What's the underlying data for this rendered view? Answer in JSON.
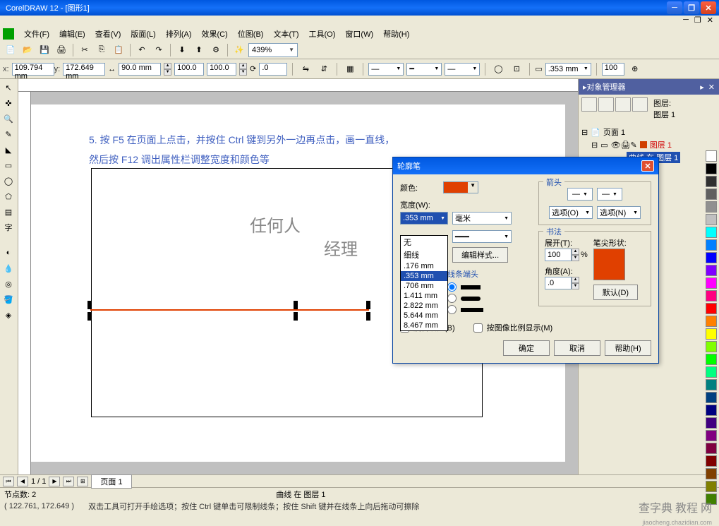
{
  "app": {
    "title": "CorelDRAW 12 - [图形1]"
  },
  "menu": [
    "文件(F)",
    "编辑(E)",
    "查看(V)",
    "版面(L)",
    "排列(A)",
    "效果(C)",
    "位图(B)",
    "文本(T)",
    "工具(O)",
    "窗口(W)",
    "帮助(H)"
  ],
  "zoom": "439%",
  "coords": {
    "x": "109.794 mm",
    "y": "172.649 mm",
    "w": "90.0 mm",
    "scale1": "100.0",
    "scale2": "100.0",
    "angle": ".0",
    "outline_w": ".353 mm",
    "opacity": "100"
  },
  "canvas": {
    "instr1": "5. 按 F5 在页面上点击，并按住 Ctrl 键到另外一边再点击，画一直线，",
    "instr2": "然后按 F12 调出属性栏调整宽度和颜色等",
    "text1": "任何人",
    "text2": "经理"
  },
  "panel": {
    "title": "对象管理器",
    "layer_label": "图层:",
    "layer_name": "图层 1",
    "page": "页面 1",
    "layer_item": "图层 1",
    "curve_item": "曲线 在 图层 1"
  },
  "dialog": {
    "title": "轮廓笔",
    "color_label": "颜色:",
    "width_label": "宽度(W):",
    "width_value": ".353 mm",
    "width_unit": "毫米",
    "width_options": [
      "无",
      "细线",
      ".176 mm",
      ".353 mm",
      ".706 mm",
      "1.411 mm",
      "2.822 mm",
      "5.644 mm",
      "8.467 mm"
    ],
    "style_btn": "编辑样式...",
    "arrows_title": "箭头",
    "options_left": "选项(O)",
    "options_right": "选项(N)",
    "calligraphy_title": "书法",
    "stretch_label": "展开(T):",
    "stretch_value": "100",
    "angle_label": "角度(A):",
    "angle_value": ".0",
    "nib_label": "笔尖形状:",
    "default_btn": "默认(D)",
    "line_caps_title": "线条端头",
    "bg_fill": "后台填充(B)",
    "scale_img": "按图像比例显示(M)",
    "ok": "确定",
    "cancel": "取消",
    "help": "帮助(H)"
  },
  "pages": {
    "count": "1 / 1",
    "tab": "页面 1"
  },
  "status": {
    "nodes": "节点数: 2",
    "pos": "( 122.761, 172.649 )",
    "hint": "双击工具可打开手绘选项；按住 Ctrl 键单击可限制线条；按住 Shift 键并在线条上向后拖动可擦除",
    "selection": "曲线 在 图层 1"
  },
  "watermark": {
    "main": "查字典 教程 网",
    "sub": "jiaocheng.chazidian.com"
  },
  "palette_colors": [
    "#ffffff",
    "#000000",
    "#303030",
    "#606060",
    "#909090",
    "#c0c0c0",
    "#00ffff",
    "#0080ff",
    "#0000ff",
    "#8000ff",
    "#ff00ff",
    "#ff0080",
    "#ff0000",
    "#ff8000",
    "#ffff00",
    "#80ff00",
    "#00ff00",
    "#00ff80",
    "#008080",
    "#004080",
    "#000080",
    "#400080",
    "#800080",
    "#800040",
    "#800000",
    "#804000",
    "#808000",
    "#408000"
  ]
}
